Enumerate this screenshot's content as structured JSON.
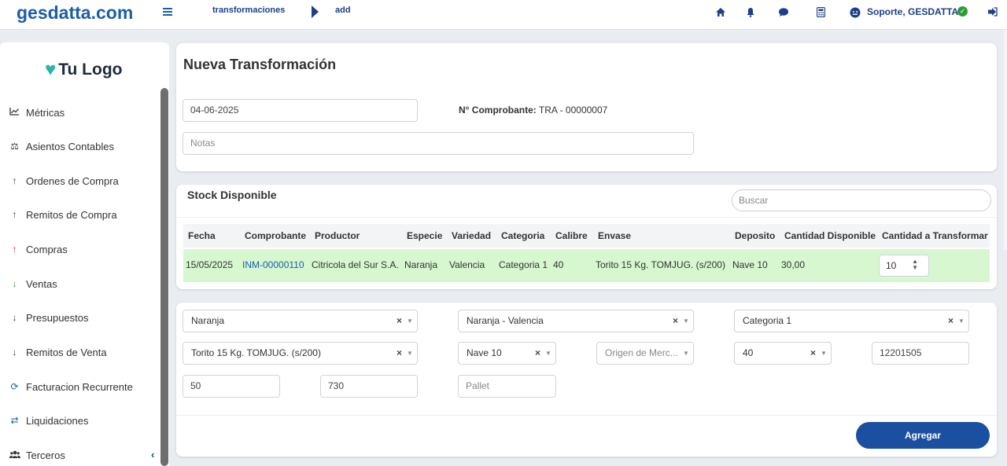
{
  "header": {
    "brand": "gesdatta.com",
    "breadcrumb": [
      "transformaciones",
      "add"
    ],
    "user": "Soporte, GESDATTA",
    "icons": [
      "home-icon",
      "bell-icon",
      "chat-icon",
      "calculator-icon",
      "user-icon",
      "check-icon",
      "logout-icon"
    ]
  },
  "sidebar": {
    "logo": "Tu Logo",
    "items": [
      {
        "label": "Métricas",
        "icon": "chart-icon"
      },
      {
        "label": "Asientos Contables",
        "icon": "scale-icon"
      },
      {
        "label": "Ordenes de Compra",
        "icon": "arrow-up-icon"
      },
      {
        "label": "Remitos de Compra",
        "icon": "arrow-up-icon"
      },
      {
        "label": "Compras",
        "icon": "arrow-up-red-icon"
      },
      {
        "label": "Ventas",
        "icon": "arrow-down-green-icon"
      },
      {
        "label": "Presupuestos",
        "icon": "arrow-down-icon"
      },
      {
        "label": "Remitos de Venta",
        "icon": "arrow-down-icon"
      },
      {
        "label": "Facturacion Recurrente",
        "icon": "sync-icon"
      },
      {
        "label": "Liquidaciones",
        "icon": "exchange-icon"
      },
      {
        "label": "Terceros",
        "icon": "users-icon"
      }
    ]
  },
  "form": {
    "title": "Nueva Transformación",
    "date": "04-06-2025",
    "comprobante_label": "N° Comprobante:",
    "comprobante_value": "TRA - 00000007",
    "notes_placeholder": "Notas"
  },
  "stock": {
    "title": "Stock Disponible",
    "search_placeholder": "Buscar",
    "columns": [
      "Fecha",
      "Comprobante",
      "Productor",
      "Especie",
      "Variedad",
      "Categoria",
      "Calibre",
      "Envase",
      "Deposito",
      "Cantidad Disponible",
      "Cantidad a Transformar"
    ],
    "row": {
      "fecha": "15/05/2025",
      "comprobante": "INM-00000110",
      "productor": "Citricola del Sur S.A.",
      "especie": "Naranja",
      "variedad": "Valencia",
      "categoria": "Categoria 1",
      "calibre": "40",
      "envase": "Torito 15 Kg. TOMJUG. (s/200)",
      "deposito": "Nave 10",
      "cantidad_disponible": "30,00",
      "cantidad_transformar": "10"
    }
  },
  "target": {
    "especie": "Naranja",
    "variedad": "Naranja - Valencia",
    "categoria": "Categoria 1",
    "envase": "Torito 15 Kg. TOMJUG. (s/200)",
    "deposito": "Nave 10",
    "origen_placeholder": "Origen de Merc...",
    "calibre": "40",
    "code": "12201505",
    "field1": "50",
    "field2": "730",
    "pallet_placeholder": "Pallet",
    "clear_symbol": "×",
    "add_button": "Agregar"
  }
}
